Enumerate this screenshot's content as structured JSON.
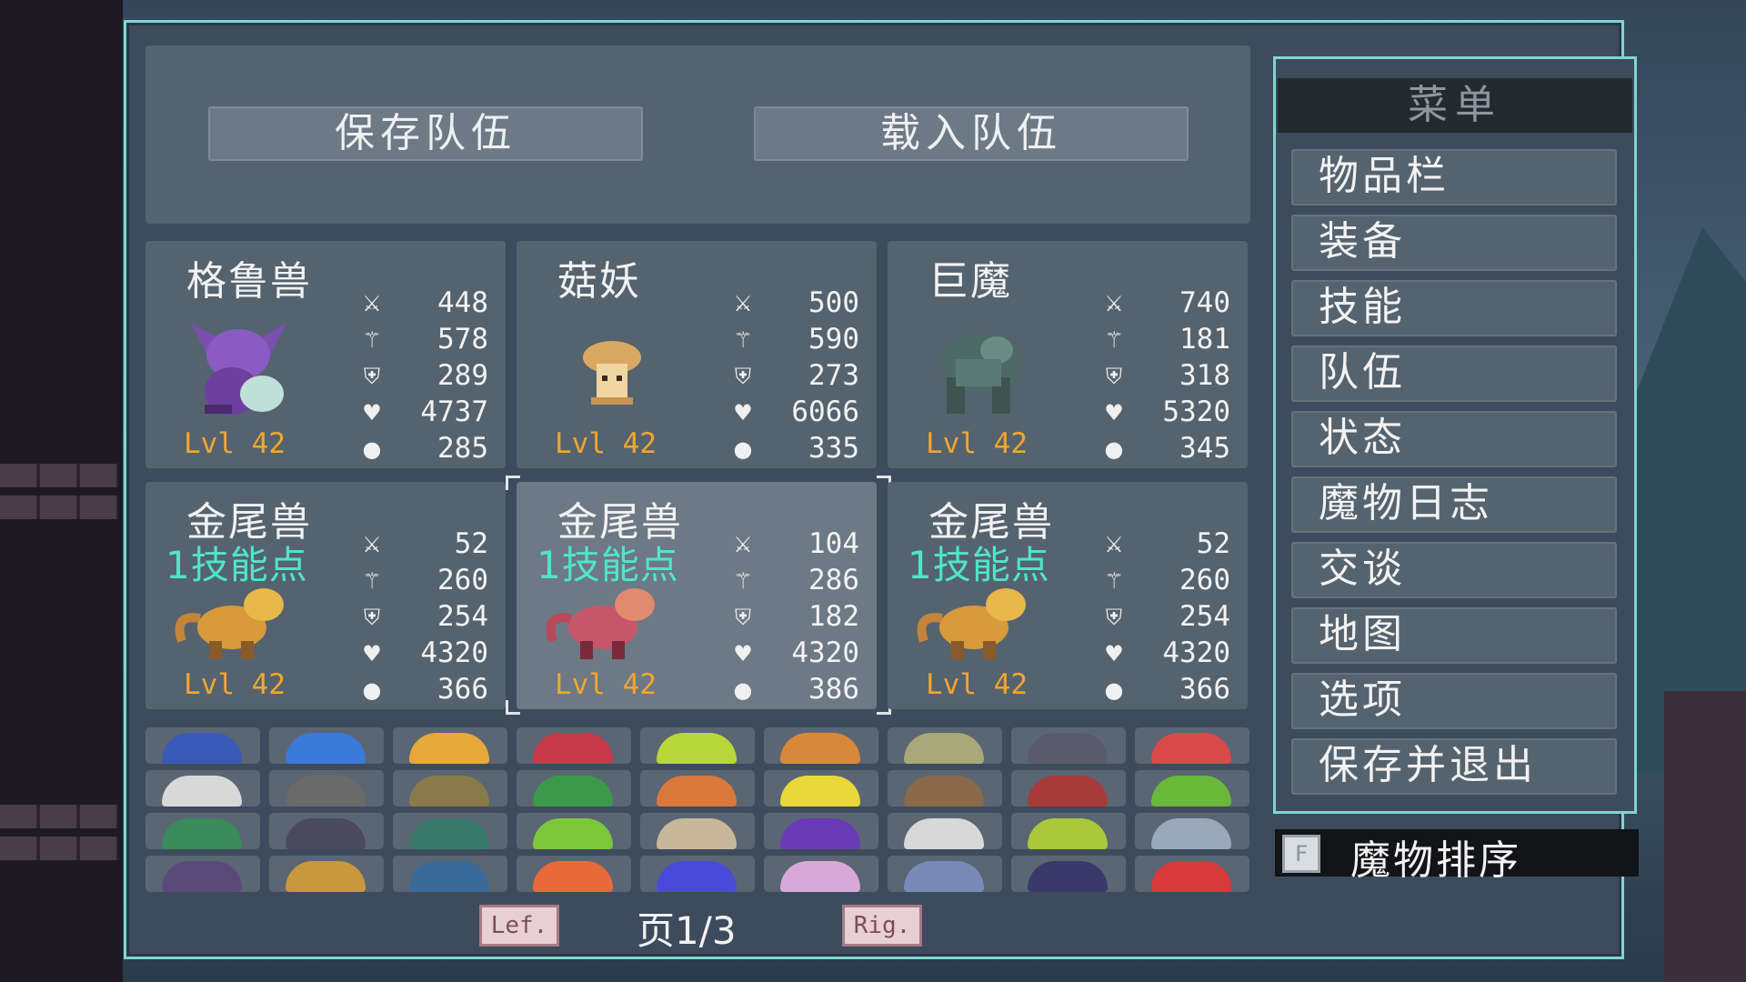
{
  "team_buttons": {
    "save": "保存队伍",
    "load": "载入队伍"
  },
  "monsters": [
    {
      "name": "格鲁兽",
      "level": "Lvl 42",
      "skill_points": "",
      "stats": [
        "448",
        "578",
        "289",
        "4737",
        "285"
      ]
    },
    {
      "name": "菇妖",
      "level": "Lvl 42",
      "skill_points": "",
      "stats": [
        "500",
        "590",
        "273",
        "6066",
        "335"
      ]
    },
    {
      "name": "巨魔",
      "level": "Lvl 42",
      "skill_points": "",
      "stats": [
        "740",
        "181",
        "318",
        "5320",
        "345"
      ]
    },
    {
      "name": "金尾兽",
      "level": "Lvl 42",
      "skill_points": "1技能点",
      "stats": [
        "52",
        "260",
        "254",
        "4320",
        "366"
      ]
    },
    {
      "name": "金尾兽",
      "level": "Lvl 42",
      "skill_points": "1技能点",
      "stats": [
        "104",
        "286",
        "182",
        "4320",
        "386"
      ]
    },
    {
      "name": "金尾兽",
      "level": "Lvl 42",
      "skill_points": "1技能点",
      "stats": [
        "52",
        "260",
        "254",
        "4320",
        "366"
      ]
    }
  ],
  "stat_icons": [
    "sword-icon",
    "staff-icon",
    "shield-icon",
    "heart-icon",
    "mana-icon"
  ],
  "pagination": {
    "prev": "Lef.",
    "next": "Rig.",
    "label": "页1/3"
  },
  "menu": {
    "title": "菜单",
    "items": [
      "物品栏",
      "装备",
      "技能",
      "队伍",
      "状态",
      "魔物日志",
      "交谈",
      "地图",
      "选项",
      "保存并退出"
    ]
  },
  "sort": {
    "key": "F",
    "label": "魔物排序"
  },
  "colors": {
    "frame": "#7fd6cf",
    "level": "#f2a62e",
    "skill_points": "#4fe6c6"
  }
}
